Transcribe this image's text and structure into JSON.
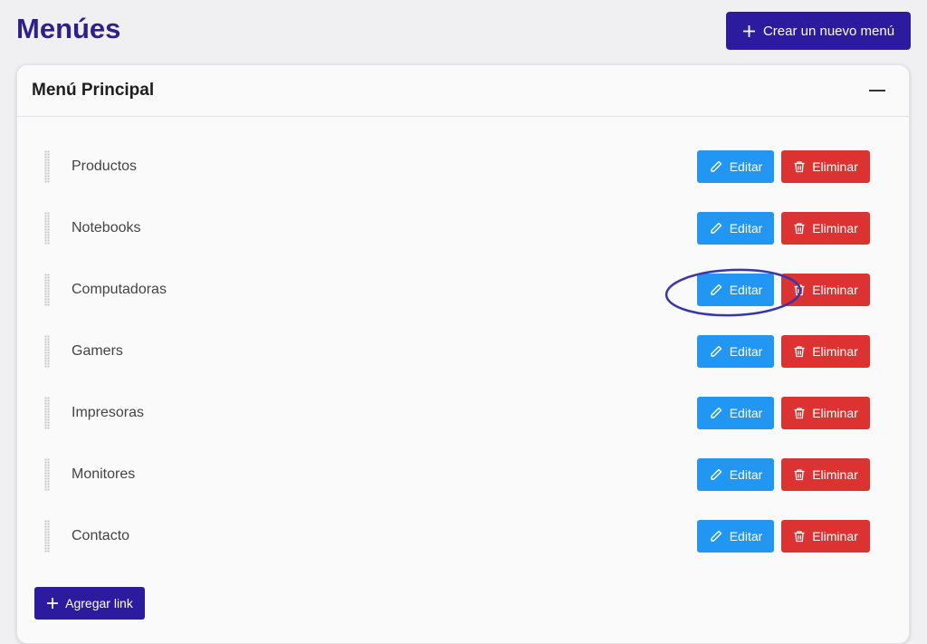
{
  "page": {
    "title": "Menúes"
  },
  "header": {
    "create_label": "Crear un nuevo menú"
  },
  "menu": {
    "title": "Menú Principal",
    "items": [
      {
        "label": "Productos"
      },
      {
        "label": "Notebooks"
      },
      {
        "label": "Computadoras"
      },
      {
        "label": "Gamers"
      },
      {
        "label": "Impresoras"
      },
      {
        "label": "Monitores"
      },
      {
        "label": "Contacto"
      }
    ],
    "edit_label": "Editar",
    "delete_label": "Eliminar",
    "add_link_label": "Agregar link"
  },
  "colors": {
    "primary": "#2c1b9e",
    "edit": "#2196f3",
    "delete": "#dc3232",
    "annotation": "#3a36a8"
  },
  "icons": {
    "create": "plus-icon",
    "collapse": "minus-icon",
    "edit": "pencil-icon",
    "delete": "trash-icon",
    "drag": "drag-handle-icon"
  }
}
